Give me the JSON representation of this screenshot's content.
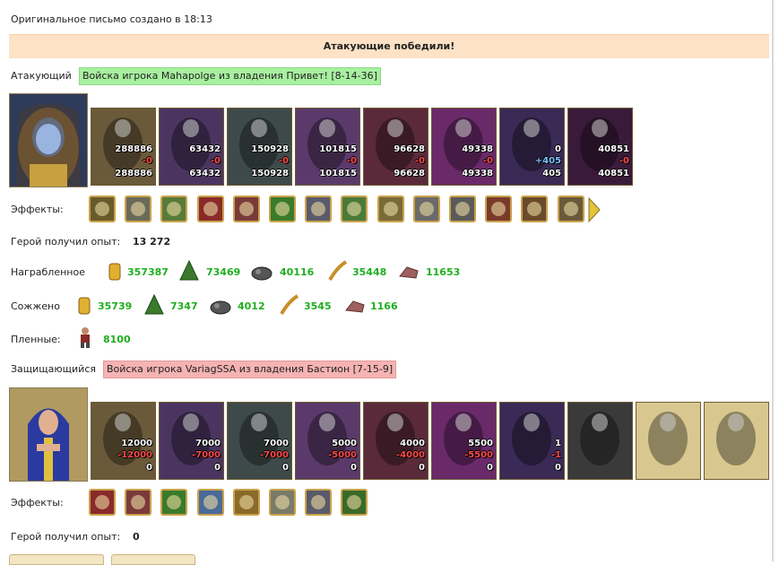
{
  "created": "Оригинальное письмо создано в 18:13",
  "banner": "Атакующие победили!",
  "attacker": {
    "label": "Атакующий",
    "tag": "Войска игрока Mahapolge из владения Привет! [8-14-36]",
    "units": [
      {
        "n1": "288886",
        "n2": "-0",
        "n3": "288886",
        "color": "#6a5a3a",
        "icon": "ogre-unit"
      },
      {
        "n1": "63432",
        "n2": "-0",
        "n3": "63432",
        "color": "#4b3560",
        "icon": "assassin-unit"
      },
      {
        "n1": "150928",
        "n2": "-0",
        "n3": "150928",
        "color": "#3e4a4a",
        "icon": "lizard-rider-unit"
      },
      {
        "n1": "101815",
        "n2": "-0",
        "n3": "101815",
        "color": "#5b3a6b",
        "icon": "harpy-unit"
      },
      {
        "n1": "96628",
        "n2": "-0",
        "n3": "96628",
        "color": "#5a2a3a",
        "icon": "archer-unit"
      },
      {
        "n1": "49338",
        "n2": "-0",
        "n3": "49338",
        "color": "#6a2a6a",
        "icon": "sorceress-unit"
      },
      {
        "n1": "0",
        "n2": "+405",
        "n3": "405",
        "color": "#3a2a55",
        "icon": "dark-knight-unit"
      },
      {
        "n1": "40851",
        "n2": "-0",
        "n3": "40851",
        "color": "#3a1a3a",
        "icon": "spider-unit"
      }
    ],
    "effects_label": "Эффекты:",
    "effects": [
      "hourglass-icon",
      "skull-bone-icon",
      "arrow-scroll-icon",
      "heart-icon",
      "hand-heart-icon",
      "green-potion-icon",
      "sword-icon",
      "potion-plus-icon",
      "candle-icon",
      "skull-helmet-icon",
      "web-icon",
      "shield-icon",
      "chest-icon",
      "claw-icon"
    ],
    "exp_label": "Герой получил опыт:",
    "exp": "13 272",
    "loot_label": "Награбленное",
    "loot": [
      {
        "icon": "gold-icon",
        "value": "357387"
      },
      {
        "icon": "wood-icon",
        "value": "73469"
      },
      {
        "icon": "ore-icon",
        "value": "40116"
      },
      {
        "icon": "grain-icon",
        "value": "35448"
      },
      {
        "icon": "stone-icon",
        "value": "11653"
      }
    ],
    "burned_label": "Сожжено",
    "burned": [
      {
        "icon": "gold-icon",
        "value": "35739"
      },
      {
        "icon": "wood-icon",
        "value": "7347"
      },
      {
        "icon": "ore-icon",
        "value": "4012"
      },
      {
        "icon": "grain-icon",
        "value": "3545"
      },
      {
        "icon": "stone-icon",
        "value": "1166"
      }
    ],
    "captives_label": "Пленные:",
    "captives": "8100"
  },
  "defender": {
    "label": "Защищающийся",
    "tag": "Войска игрока VariagSSA из владения Бастион [7-15-9]",
    "units": [
      {
        "n1": "12000",
        "n2": "-12000",
        "n3": "0",
        "color": "#6a5a3a",
        "icon": "ogre-unit"
      },
      {
        "n1": "7000",
        "n2": "-7000",
        "n3": "0",
        "color": "#4b3560",
        "icon": "assassin-unit"
      },
      {
        "n1": "7000",
        "n2": "-7000",
        "n3": "0",
        "color": "#3e4a4a",
        "icon": "lizard-rider-unit"
      },
      {
        "n1": "5000",
        "n2": "-5000",
        "n3": "0",
        "color": "#5b3a6b",
        "icon": "harpy-unit"
      },
      {
        "n1": "4000",
        "n2": "-4000",
        "n3": "0",
        "color": "#5a2a3a",
        "icon": "archer-unit"
      },
      {
        "n1": "5500",
        "n2": "-5500",
        "n3": "0",
        "color": "#6a2a6a",
        "icon": "sorceress-unit"
      },
      {
        "n1": "1",
        "n2": "-1",
        "n3": "0",
        "color": "#3a2a55",
        "icon": "dark-knight-unit"
      },
      {
        "n1": "",
        "n2": "",
        "n3": "",
        "color": "#3a3a3a",
        "icon": "grey-spider-unit"
      },
      {
        "n1": "",
        "n2": "",
        "n3": "",
        "color": "#d8c890",
        "icon": "crystal-orb-unit"
      },
      {
        "n1": "",
        "n2": "",
        "n3": "",
        "color": "#d8c890",
        "icon": "crystal-orb-unit"
      }
    ],
    "effects_label": "Эффекты:",
    "effects": [
      "heart-icon",
      "hand-heart-icon",
      "green-potion-icon",
      "question-icon",
      "bee-icon",
      "scroll-icon",
      "sword-icon",
      "xp-icon"
    ],
    "exp_label": "Герой получил опыт:",
    "exp": "0"
  }
}
